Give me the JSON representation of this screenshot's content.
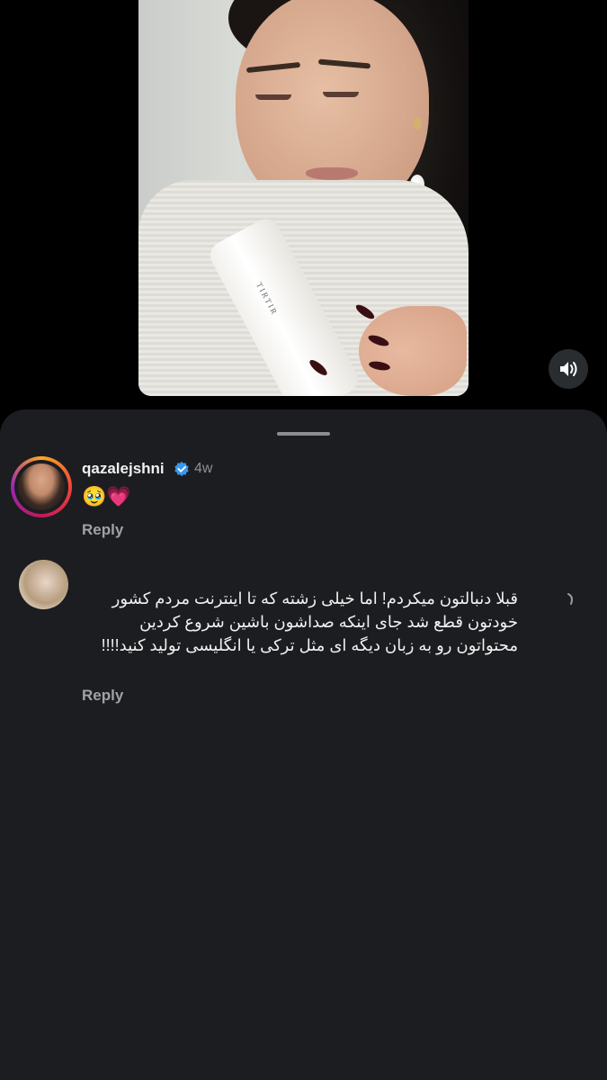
{
  "video": {
    "product_label": "TIRTIR"
  },
  "sound_button": {
    "icon": "volume-icon"
  },
  "comments_sheet": {
    "comments": [
      {
        "username": "qazalejshni",
        "verified": true,
        "time": "4w",
        "text": "🥹💗",
        "reply_label": "Reply"
      },
      {
        "username": "",
        "text": "قبلا دنبالتون میکردم! اما خیلی زشته که تا اینترنت مردم کشور خودتون قطع شد جای اینکه صداشون باشین شروع کردین محتواتون رو به زبان دیگه ای مثل ترکی یا انگلیسی تولید کنید!!!!",
        "reply_label": "Reply"
      }
    ]
  },
  "colors": {
    "background": "#000000",
    "sheet": "#1b1d20",
    "text_primary": "#f1f1f1",
    "text_secondary": "#8e9094",
    "verified": "#3897f0"
  }
}
